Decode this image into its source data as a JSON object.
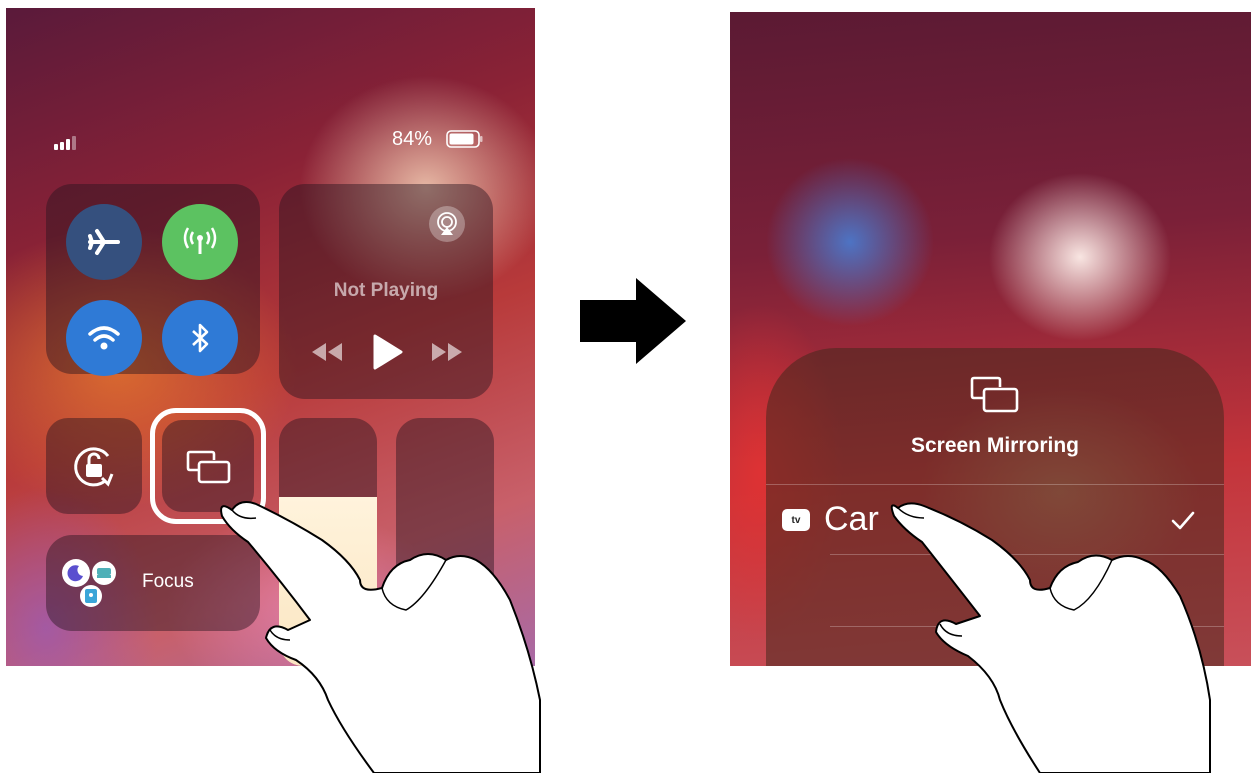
{
  "left": {
    "status": {
      "battery_percent": "84%",
      "signal_bars": 3,
      "battery_level": 0.84
    },
    "connectivity": [
      {
        "name": "airplane-icon",
        "on": false
      },
      {
        "name": "cellular-icon",
        "on": true
      },
      {
        "name": "wifi-icon",
        "on": true
      },
      {
        "name": "bluetooth-icon",
        "on": true
      }
    ],
    "media": {
      "title": "Not Playing",
      "airplay_icon": "airplay-icon"
    },
    "screen_mirroring_icon": "screen-mirroring-icon",
    "rotation_lock_icon": "rotation-lock-icon",
    "brightness_level": 0.68,
    "focus": {
      "label": "Focus"
    }
  },
  "right": {
    "header": {
      "title": "Screen Mirroring",
      "icon": "screen-mirroring-icon"
    },
    "devices": [
      {
        "badge": "tv",
        "name": "Car",
        "selected": true
      }
    ]
  },
  "colors": {
    "cellular_on": "#5cc261",
    "toggle_on": "#2f7ad6",
    "toggle_off": "#4a3e4a",
    "highlight_ring": "#ffffff"
  }
}
